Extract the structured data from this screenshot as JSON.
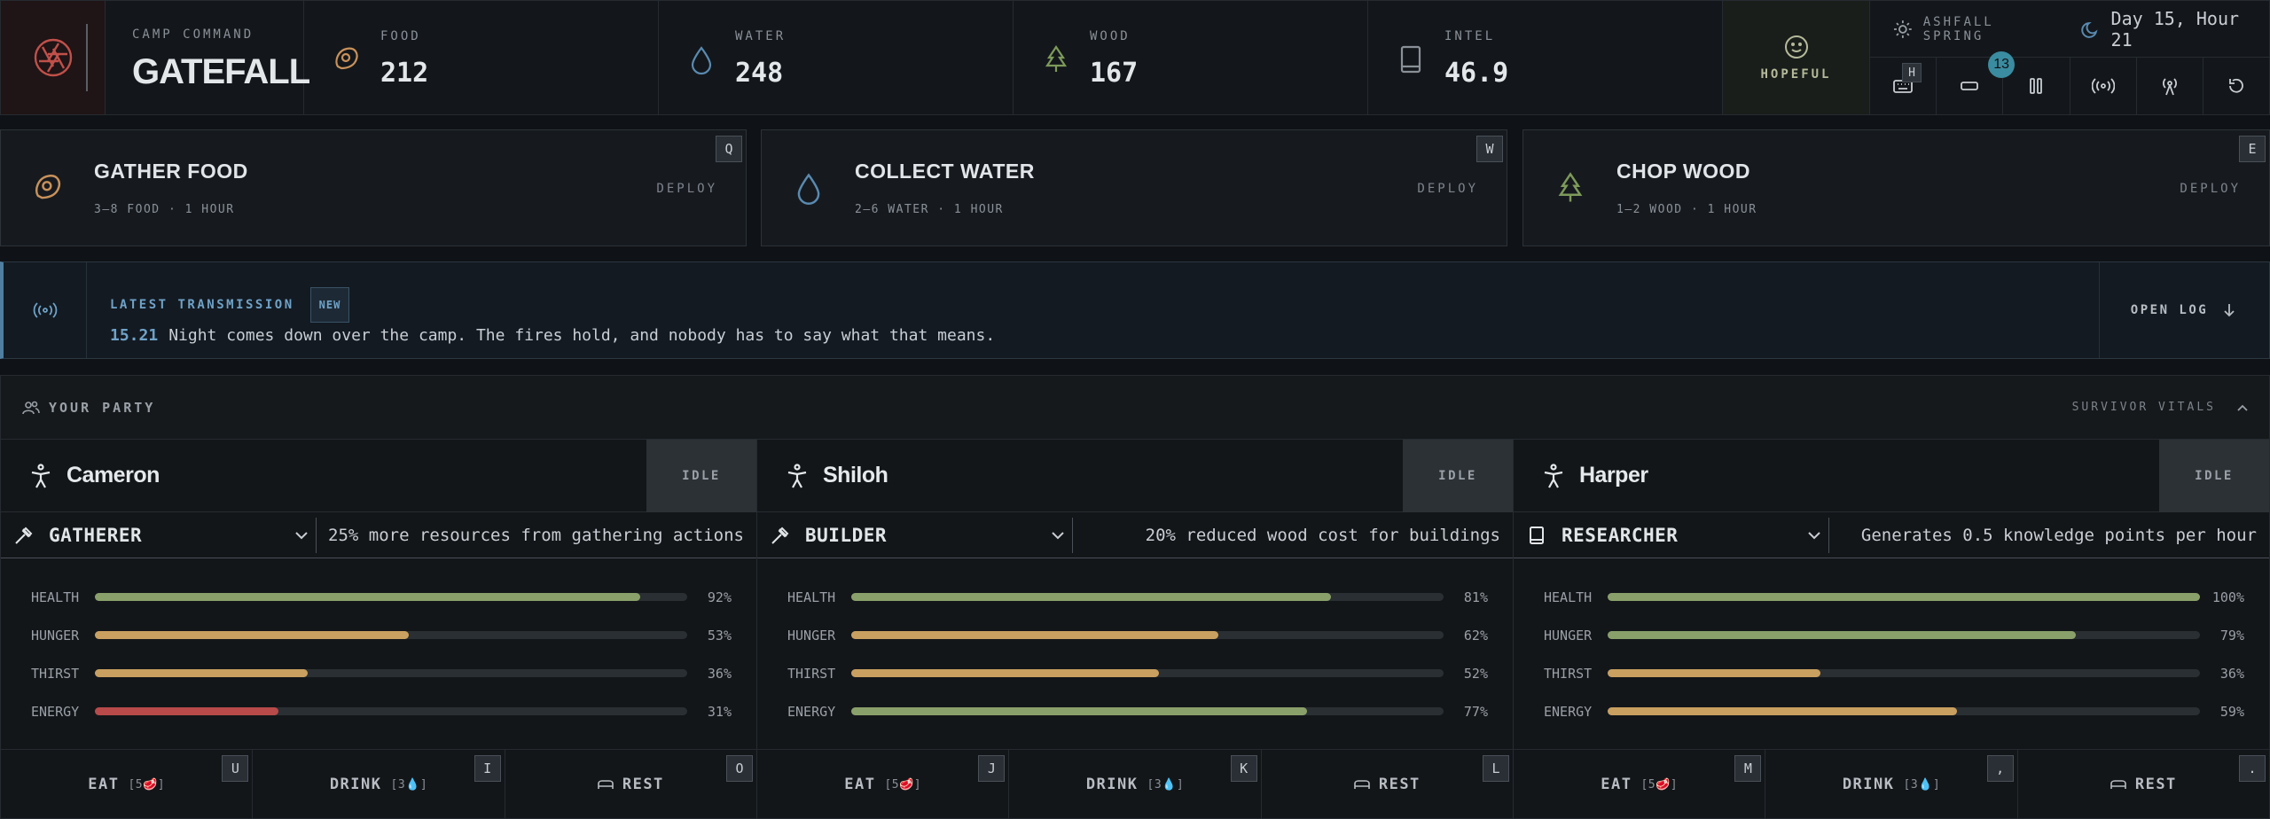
{
  "camp": {
    "label": "CAMP COMMAND",
    "name": "GATEFALL"
  },
  "resources": [
    {
      "label": "FOOD",
      "value": "212",
      "icon": "meat-icon",
      "color": "#c9915a"
    },
    {
      "label": "WATER",
      "value": "248",
      "icon": "water-drop-icon",
      "color": "#5a8ab0"
    },
    {
      "label": "WOOD",
      "value": "167",
      "icon": "tree-icon",
      "color": "#7d9a5a"
    },
    {
      "label": "INTEL",
      "value": "46.9",
      "icon": "book-icon",
      "color": "#8a9098"
    }
  ],
  "mood": {
    "label": "HOPEFUL",
    "icon": "smile-icon",
    "color": "#b5ba9a"
  },
  "season": {
    "name": "ASHFALL SPRING",
    "day": "Day 15, Hour 21"
  },
  "controls": {
    "keyboard_hotkey": "H",
    "notification_count": "13"
  },
  "actions": [
    {
      "title": "GATHER FOOD",
      "sub": "3–8 FOOD · 1 HOUR",
      "deploy": "DEPLOY",
      "key": "Q"
    },
    {
      "title": "COLLECT WATER",
      "sub": "2–6 WATER · 1 HOUR",
      "deploy": "DEPLOY",
      "key": "W"
    },
    {
      "title": "CHOP WOOD",
      "sub": "1–2 WOOD · 1 HOUR",
      "deploy": "DEPLOY",
      "key": "E"
    }
  ],
  "transmission": {
    "label": "LATEST TRANSMISSION",
    "badge": "NEW",
    "time": "15.21",
    "message": "Night comes down over the camp. The fires hold, and nobody has to say what that means.",
    "open_log": "OPEN LOG"
  },
  "party": {
    "title": "YOUR PARTY",
    "vitals_toggle": "SURVIVOR VITALS",
    "survivors": [
      {
        "name": "Cameron",
        "status": "IDLE",
        "role": "GATHERER",
        "role_desc": "25% more resources from gathering actions",
        "stats": [
          {
            "label": "HEALTH",
            "value": 92,
            "text": "92%",
            "color": "#8aa06a"
          },
          {
            "label": "HUNGER",
            "value": 53,
            "text": "53%",
            "color": "#c9a060"
          },
          {
            "label": "THIRST",
            "value": 36,
            "text": "36%",
            "color": "#c9a060"
          },
          {
            "label": "ENERGY",
            "value": 31,
            "text": "31%",
            "color": "#b84a4a"
          }
        ],
        "eat": "EAT",
        "eat_cost": "[5🥩]",
        "eat_key": "U",
        "drink": "DRINK",
        "drink_cost": "[3💧]",
        "drink_key": "I",
        "rest": "REST",
        "rest_key": "O"
      },
      {
        "name": "Shiloh",
        "status": "IDLE",
        "role": "BUILDER",
        "role_desc": "20% reduced wood cost for buildings",
        "stats": [
          {
            "label": "HEALTH",
            "value": 81,
            "text": "81%",
            "color": "#8aa06a"
          },
          {
            "label": "HUNGER",
            "value": 62,
            "text": "62%",
            "color": "#c9a060"
          },
          {
            "label": "THIRST",
            "value": 52,
            "text": "52%",
            "color": "#c9a060"
          },
          {
            "label": "ENERGY",
            "value": 77,
            "text": "77%",
            "color": "#8aa06a"
          }
        ],
        "eat": "EAT",
        "eat_cost": "[5🥩]",
        "eat_key": "J",
        "drink": "DRINK",
        "drink_cost": "[3💧]",
        "drink_key": "K",
        "rest": "REST",
        "rest_key": "L"
      },
      {
        "name": "Harper",
        "status": "IDLE",
        "role": "RESEARCHER",
        "role_desc": "Generates 0.5 knowledge points per hour",
        "stats": [
          {
            "label": "HEALTH",
            "value": 100,
            "text": "100%",
            "color": "#8aa06a"
          },
          {
            "label": "HUNGER",
            "value": 79,
            "text": "79%",
            "color": "#8aa06a"
          },
          {
            "label": "THIRST",
            "value": 36,
            "text": "36%",
            "color": "#c9a060"
          },
          {
            "label": "ENERGY",
            "value": 59,
            "text": "59%",
            "color": "#c9a060"
          }
        ],
        "eat": "EAT",
        "eat_cost": "[5🥩]",
        "eat_key": "M",
        "drink": "DRINK",
        "drink_cost": "[3💧]",
        "drink_key": ",",
        "rest": "REST",
        "rest_key": "."
      }
    ]
  }
}
